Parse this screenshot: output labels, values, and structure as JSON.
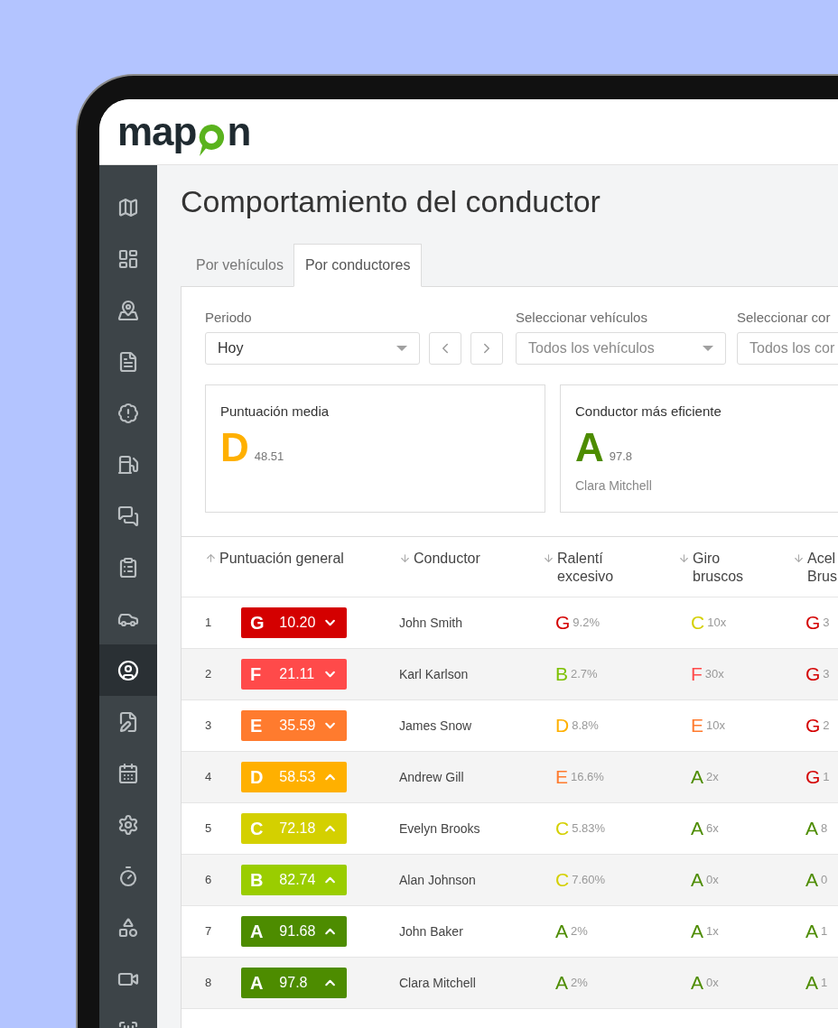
{
  "logo": {
    "before": "map",
    "after": "n"
  },
  "sidebar": {
    "items": [
      {
        "selected": false
      },
      {
        "selected": false
      },
      {
        "selected": false
      },
      {
        "selected": false
      },
      {
        "selected": false
      },
      {
        "selected": false
      },
      {
        "selected": false
      },
      {
        "selected": false
      },
      {
        "selected": false
      },
      {
        "selected": true
      },
      {
        "selected": false
      },
      {
        "selected": false
      },
      {
        "selected": false
      },
      {
        "selected": false
      },
      {
        "selected": false
      },
      {
        "selected": false
      },
      {
        "selected": false
      }
    ]
  },
  "title": "Comportamiento del conductor",
  "tabs": [
    {
      "label": "Por vehículos",
      "selected": false
    },
    {
      "label": "Por conductores",
      "selected": true
    }
  ],
  "filters": [
    {
      "label": "Periodo",
      "value": "Hoy",
      "kind": "period"
    },
    {
      "label": "Seleccionar vehículos",
      "placeholder": "Todos los vehículos",
      "kind": "select"
    },
    {
      "label": "Seleccionar cor",
      "placeholder": "Todos los cor",
      "kind": "cut"
    }
  ],
  "cards": [
    {
      "title": "Puntuación media",
      "grade": "D",
      "color": "#ffb000",
      "score": "48.51"
    },
    {
      "title": "Conductor más eficiente",
      "grade": "A",
      "color": "#4d8c00",
      "score": "97.8",
      "name": "Clara Mitchell"
    }
  ],
  "table": {
    "columns": [
      {
        "lines": [
          "Puntuación general"
        ],
        "ascending": true
      },
      {
        "lines": [
          "Conductor"
        ],
        "ascending": false
      },
      {
        "lines": [
          "Ralentí",
          "excesivo"
        ],
        "ascending": false
      },
      {
        "lines": [
          "Giro",
          "bruscos"
        ],
        "ascending": false
      },
      {
        "lines": [
          "Acel",
          "Brus"
        ],
        "ascending": false
      }
    ],
    "rows": [
      {
        "cells": [
          {
            "kind": "overall",
            "rank": "1",
            "grade": "G",
            "color": "#d40000",
            "score": "10.20",
            "improving": false
          },
          {
            "kind": "driver",
            "text": "John Smith"
          },
          {
            "kind": "metric",
            "grade": "G",
            "color": "#d40000",
            "value": "9.2%"
          },
          {
            "kind": "metric",
            "grade": "C",
            "color": "#d4d000",
            "value": "10x"
          },
          {
            "kind": "metric",
            "grade": "G",
            "color": "#d40000",
            "value": "3"
          }
        ]
      },
      {
        "cells": [
          {
            "kind": "overall",
            "rank": "2",
            "grade": "F",
            "color": "#ff4a4a",
            "score": "21.11",
            "improving": false
          },
          {
            "kind": "driver",
            "text": "Karl Karlson"
          },
          {
            "kind": "metric",
            "grade": "B",
            "color": "#7cc000",
            "value": "2.7%"
          },
          {
            "kind": "metric",
            "grade": "F",
            "color": "#ff4a4a",
            "value": "30x"
          },
          {
            "kind": "metric",
            "grade": "G",
            "color": "#d40000",
            "value": "3"
          }
        ]
      },
      {
        "cells": [
          {
            "kind": "overall",
            "rank": "3",
            "grade": "E",
            "color": "#ff7b2e",
            "score": "35.59",
            "improving": false
          },
          {
            "kind": "driver",
            "text": "James Snow"
          },
          {
            "kind": "metric",
            "grade": "D",
            "color": "#ffb000",
            "value": "8.8%"
          },
          {
            "kind": "metric",
            "grade": "E",
            "color": "#ff7b2e",
            "value": "10x"
          },
          {
            "kind": "metric",
            "grade": "G",
            "color": "#d40000",
            "value": "2"
          }
        ]
      },
      {
        "cells": [
          {
            "kind": "overall",
            "rank": "4",
            "grade": "D",
            "color": "#ffb000",
            "score": "58.53",
            "improving": true
          },
          {
            "kind": "driver",
            "text": "Andrew Gill"
          },
          {
            "kind": "metric",
            "grade": "E",
            "color": "#ff7b2e",
            "value": "16.6%"
          },
          {
            "kind": "metric",
            "grade": "A",
            "color": "#4d8c00",
            "value": "2x"
          },
          {
            "kind": "metric",
            "grade": "G",
            "color": "#d40000",
            "value": "1"
          }
        ]
      },
      {
        "cells": [
          {
            "kind": "overall",
            "rank": "5",
            "grade": "C",
            "color": "#d4d000",
            "score": "72.18",
            "improving": true
          },
          {
            "kind": "driver",
            "text": "Evelyn Brooks"
          },
          {
            "kind": "metric",
            "grade": "C",
            "color": "#d4d000",
            "value": "5.83%"
          },
          {
            "kind": "metric",
            "grade": "A",
            "color": "#4d8c00",
            "value": "6x"
          },
          {
            "kind": "metric",
            "grade": "A",
            "color": "#4d8c00",
            "value": "8"
          }
        ]
      },
      {
        "cells": [
          {
            "kind": "overall",
            "rank": "6",
            "grade": "B",
            "color": "#9acd00",
            "score": "82.74",
            "improving": true
          },
          {
            "kind": "driver",
            "text": "Alan Johnson"
          },
          {
            "kind": "metric",
            "grade": "C",
            "color": "#d4d000",
            "value": "7.60%"
          },
          {
            "kind": "metric",
            "grade": "A",
            "color": "#4d8c00",
            "value": "0x"
          },
          {
            "kind": "metric",
            "grade": "A",
            "color": "#4d8c00",
            "value": "0"
          }
        ]
      },
      {
        "cells": [
          {
            "kind": "overall",
            "rank": "7",
            "grade": "A",
            "color": "#4d8c00",
            "score": "91.68",
            "improving": true
          },
          {
            "kind": "driver",
            "text": "John Baker"
          },
          {
            "kind": "metric",
            "grade": "A",
            "color": "#4d8c00",
            "value": "2%"
          },
          {
            "kind": "metric",
            "grade": "A",
            "color": "#4d8c00",
            "value": "1x"
          },
          {
            "kind": "metric",
            "grade": "A",
            "color": "#4d8c00",
            "value": "1"
          }
        ]
      },
      {
        "cells": [
          {
            "kind": "overall",
            "rank": "8",
            "grade": "A",
            "color": "#4d8c00",
            "score": "97.8",
            "improving": true
          },
          {
            "kind": "driver",
            "text": "Clara Mitchell"
          },
          {
            "kind": "metric",
            "grade": "A",
            "color": "#4d8c00",
            "value": "2%"
          },
          {
            "kind": "metric",
            "grade": "A",
            "color": "#4d8c00",
            "value": "0x"
          },
          {
            "kind": "metric",
            "grade": "A",
            "color": "#4d8c00",
            "value": "1"
          }
        ]
      }
    ]
  }
}
